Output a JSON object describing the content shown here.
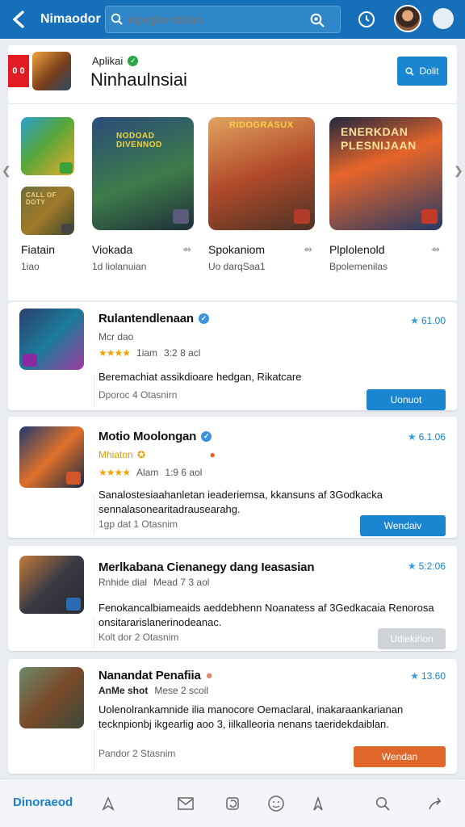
{
  "topbar": {
    "title": "Nimaodor",
    "search_placeholder": "ikpegherotitiah",
    "colors": {
      "bar": "#1670b9"
    },
    "icons": [
      "back-arrow-icon",
      "search-icon",
      "camera-search-icon",
      "clock-icon",
      "avatar",
      "profile-dot"
    ]
  },
  "header": {
    "tag": "0 0",
    "subtitle": "Aplikai",
    "title": "Ninhaulnsiai",
    "button_label": "Dolit"
  },
  "carousel": {
    "small_labels": [
      "",
      "CALL OF DOTY"
    ],
    "big_labels": [
      "NODOAD DIVENNOD",
      "RIDOGRASUX",
      "ENERKDAN PLESNIJAAN"
    ],
    "items": [
      {
        "name": "Fiatain",
        "sub": "1iao"
      },
      {
        "name": "Viokada",
        "sub": "1d liolanuian"
      },
      {
        "name": "Spokaniom",
        "sub": "Uo darqSaa1"
      },
      {
        "name": "Plplolenold",
        "sub": "Bpolemenilas"
      }
    ]
  },
  "cards": [
    {
      "title": "Rulantendlenaan",
      "rating": "61.00",
      "dev": "Mcr dao",
      "stars": "★★★★",
      "reviews": "1iam",
      "size": "3:2 8 acl",
      "desc": "Beremachiat assikdioare hedgan, Rikatcare",
      "meta": "Dporoc 4 Otasnirn",
      "action": "Uonuot",
      "action_color": "#1a86d1"
    },
    {
      "title": "Motio Moolongan",
      "rating": "6.1.06",
      "dev": "Mhiaton",
      "stars": "★★★★",
      "reviews": "Alam",
      "size": "1:9 6 aol",
      "desc": "Sanalostesiaahanletan ieaderiemsa, kkansuns af 3Godkacka sennalasonearitadrausearahg.",
      "meta": "1gp dat 1 Otasnim",
      "action": "Wendaiv",
      "action_color": "#1a86d1"
    },
    {
      "title": "Merlkabana Cienanegy dang Ieasasian",
      "rating": "5:2:06",
      "dev": "Rnhide dial",
      "size": "Mead 7 3 aol",
      "desc": "Fenokancalbiameaids aeddebhenn Noanatess af 3Gedkacaia Renorosa onsitararislanerinodeanac.",
      "meta": "Kolt dor 2 Otasnim",
      "action": "Udiekirion",
      "action_color": "#cfd3d7"
    },
    {
      "title": "Nanandat Penafiia",
      "rating": "13.60",
      "dev": "AnMe shot",
      "size": "Mese 2 scoil",
      "desc": "Uolenolrankamnide ilia manocore Oemaclaral, inakaraankarianan tecknpionbj ikgearlig aoo 3, iilkalleoria nenans taeridekdaiblan.",
      "meta": "Pandor 2 Stasnim",
      "action": "Wendan",
      "action_color": "#e0672a"
    }
  ],
  "bottom_nav": {
    "label": "Dinoraeod",
    "icons": [
      "navigate-icon",
      "mail-icon",
      "refresh-icon",
      "emoji-icon",
      "bookmark-icon",
      "search-icon",
      "share-icon"
    ]
  }
}
